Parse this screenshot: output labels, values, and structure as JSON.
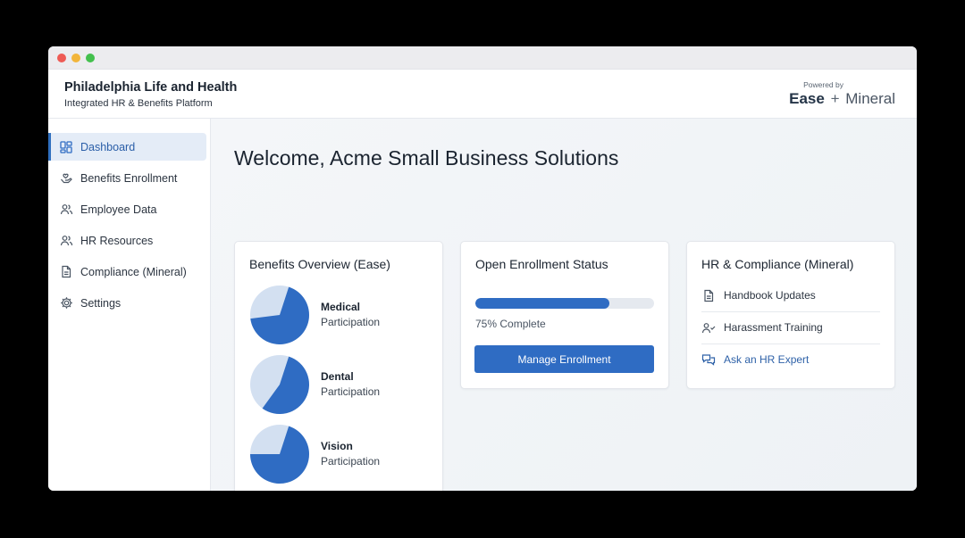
{
  "header": {
    "title": "Philadelphia Life and Health",
    "subtitle": "Integrated HR & Benefits Platform",
    "powered_by": "Powered by",
    "partner_ease": "Ease",
    "partner_plus": "+",
    "partner_mineral": "Mineral"
  },
  "sidebar": {
    "items": [
      {
        "label": "Dashboard",
        "icon": "dashboard-icon",
        "active": true
      },
      {
        "label": "Benefits Enrollment",
        "icon": "heart-hand-icon",
        "active": false
      },
      {
        "label": "Employee Data",
        "icon": "people-icon",
        "active": false
      },
      {
        "label": "HR Resources",
        "icon": "people-icon",
        "active": false
      },
      {
        "label": "Compliance (Mineral)",
        "icon": "document-icon",
        "active": false
      },
      {
        "label": "Settings",
        "icon": "gear-icon",
        "active": false
      }
    ]
  },
  "main": {
    "welcome": "Welcome, Acme Small Business Solutions",
    "benefits_card": {
      "title": "Benefits Overview (Ease)",
      "items": [
        {
          "name": "Medical",
          "sub": "Participation",
          "fraction": 0.68
        },
        {
          "name": "Dental",
          "sub": "Participation",
          "fraction": 0.55
        },
        {
          "name": "Vision",
          "sub": "Participation",
          "fraction": 0.7
        }
      ]
    },
    "enrollment_card": {
      "title": "Open Enrollment Status",
      "progress": 0.75,
      "progress_label": "75% Complete",
      "button_label": "Manage Enrollment"
    },
    "compliance_card": {
      "title": "HR & Compliance (Mineral)",
      "items": [
        {
          "label": "Handbook Updates",
          "icon": "document-icon"
        },
        {
          "label": "Harassment Training",
          "icon": "person-check-icon"
        },
        {
          "label": "Ask an HR Expert",
          "icon": "chat-icon"
        }
      ]
    }
  },
  "colors": {
    "accent": "#2f6cc3",
    "pie_light": "#d3e0f1",
    "active_bg": "#e4ecf7",
    "link": "#2f62a8"
  }
}
